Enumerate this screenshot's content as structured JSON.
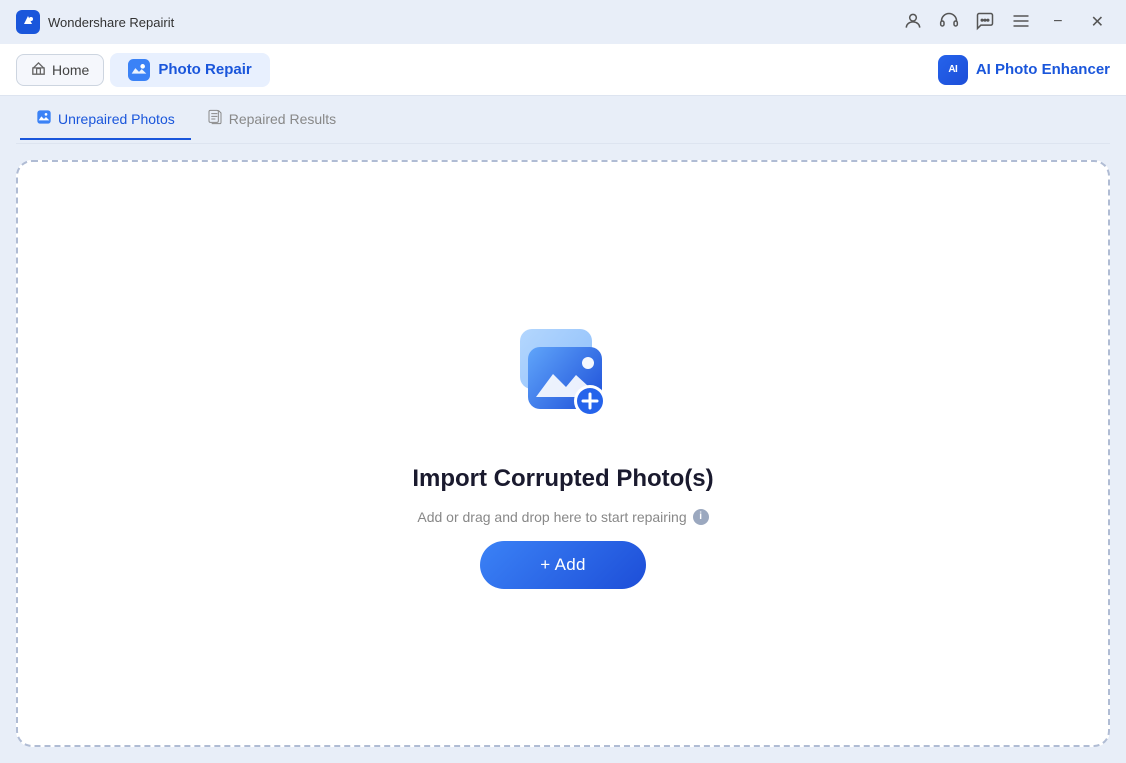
{
  "titlebar": {
    "app_name": "Wondershare Repairit",
    "minimize_label": "−",
    "close_label": "✕"
  },
  "navbar": {
    "home_label": "Home",
    "photo_repair_label": "Photo Repair",
    "ai_enhancer_badge": "AI",
    "ai_enhancer_label": "AI Photo Enhancer"
  },
  "tabs": [
    {
      "id": "unrepaired",
      "label": "Unrepaired Photos",
      "active": true
    },
    {
      "id": "repaired",
      "label": "Repaired Results",
      "active": false
    }
  ],
  "dropzone": {
    "title": "Import Corrupted Photo(s)",
    "subtitle": "Add or drag and drop here to start repairing",
    "add_button_label": "+ Add"
  },
  "colors": {
    "accent": "#1a56db",
    "button_gradient_start": "#3b82f6",
    "button_gradient_end": "#1d4ed8"
  }
}
